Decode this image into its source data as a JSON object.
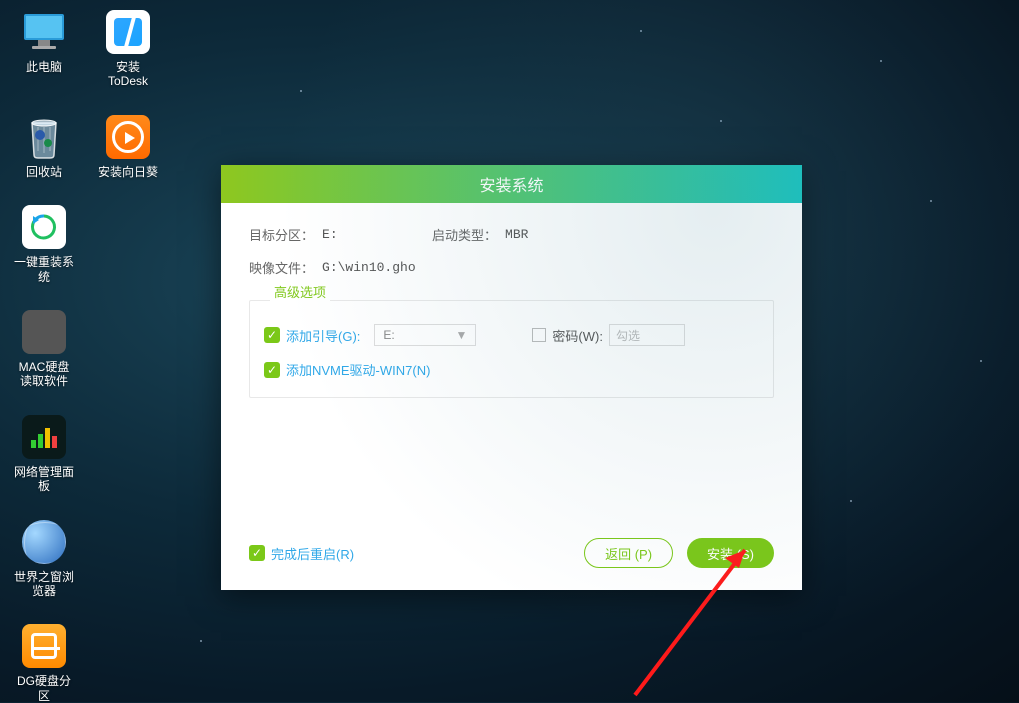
{
  "desktop": {
    "icons": [
      {
        "label": "此电脑"
      },
      {
        "label": "安装ToDesk"
      },
      {
        "label": "回收站"
      },
      {
        "label": "安装向日葵"
      },
      {
        "label": "一键重装系统"
      },
      {
        "label": "MAC硬盘读取软件"
      },
      {
        "label": "网络管理面板"
      },
      {
        "label": "世界之窗浏览器"
      },
      {
        "label": "DG硬盘分区"
      }
    ]
  },
  "dialog": {
    "title": "安装系统",
    "target_partition_label": "目标分区：",
    "target_partition_value": "E:",
    "boot_type_label": "启动类型：",
    "boot_type_value": "MBR",
    "image_file_label": "映像文件：",
    "image_file_value": "G:\\win10.gho",
    "advanced_legend": "高级选项",
    "add_boot_label": "添加引导(G):",
    "add_boot_value": "E:",
    "password_label": "密码(W):",
    "password_placeholder": "勾选",
    "add_nvme_label": "添加NVME驱动-WIN7(N)",
    "restart_label": "完成后重启(R)",
    "back_button": "返回 (P)",
    "install_button": "安装 (S)"
  }
}
